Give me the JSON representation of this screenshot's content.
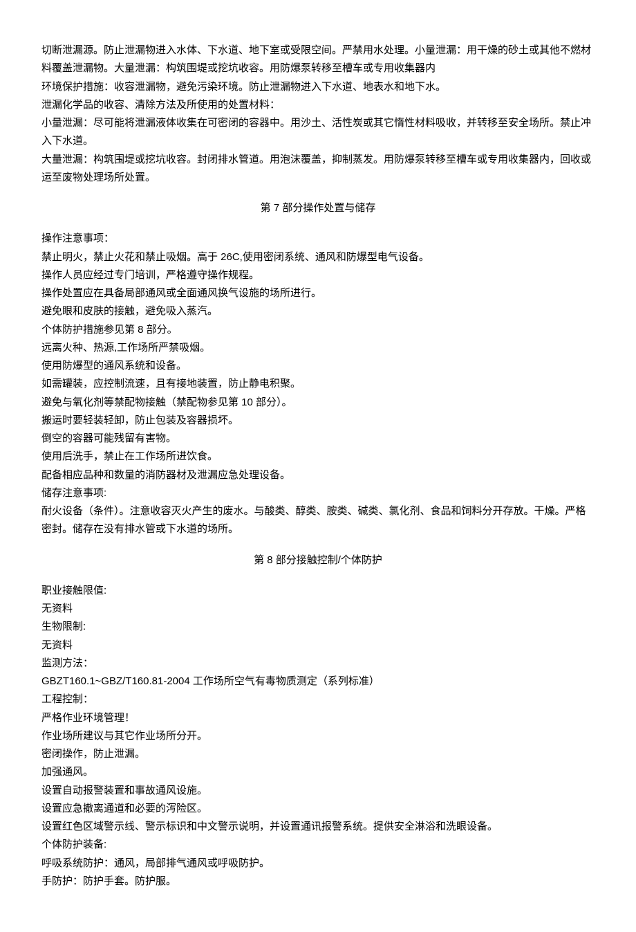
{
  "sec6": {
    "p1": "切断泄漏源。防止泄漏物进入水体、下水道、地下室或受限空间。严禁用水处理。小量泄漏：用干燥的砂土或其他不燃材料覆盖泄漏物。大量泄漏：构筑围堤或挖坑收容。用防爆泵转移至槽车或专用收集器内",
    "p2": "环境保护措施：收容泄漏物，避免污染环境。防止泄漏物进入下水道、地表水和地下水。",
    "p3": "泄漏化学品的收容、清除方法及所使用的处置材料：",
    "p4": "小量泄漏：尽可能将泄漏液体收集在可密闭的容器中。用沙土、活性炭或其它惰性材料吸收，并转移至安全场所。禁止冲入下水道。",
    "p5": "大量泄漏：构筑围堤或挖坑收容。封闭排水管道。用泡沫覆盖，抑制蒸发。用防爆泵转移至槽车或专用收集器内，回收或运至废物处理场所处置。"
  },
  "sec7": {
    "heading": "第 7 部分操作处置与储存",
    "p1": "操作注意事项：",
    "p2": "禁止明火，禁止火花和禁止吸烟。高于 26C,使用密闭系统、通风和防爆型电气设备。",
    "p3": "操作人员应经过专门培训，严格遵守操作规程。",
    "p4": "操作处置应在具备局部通风或全面通风换气设施的场所进行。",
    "p5": "避免眼和皮肤的接触，避免吸入蒸汽。",
    "p6": "个体防护措施参见第 8 部分。",
    "p7": "远离火种、热源,工作场所严禁吸烟。",
    "p8": "使用防爆型的通风系统和设备。",
    "p9": "如需罐装，应控制流速，且有接地装置，防止静电积聚。",
    "p10": "避免与氧化剂等禁配物接触（禁配物参见第 10 部分）。",
    "p11": "搬运时要轻装轻卸，防止包装及容器损坏。",
    "p12": "倒空的容器可能残留有害物。",
    "p13": "使用后洗手，禁止在工作场所进饮食。",
    "p14": "配备相应品种和数量的消防器材及泄漏应急处理设备。",
    "p15": "储存注意事项:",
    "p16": "耐火设备（条件）。注意收容灭火产生的废水。与酸类、醇类、胺类、碱类、氯化剂、食品和饲料分开存放。干燥。严格密封。储存在没有排水管或下水道的场所。"
  },
  "sec8": {
    "heading": "第 8 部分接触控制/个体防护",
    "p1": "职业接触限值:",
    "p2": "无资料",
    "p3": "生物限制:",
    "p4": "无资料",
    "p5": "监测方法：",
    "p6": "GBZT160.1~GBZ/T160.81-2004 工作场所空气有毒物质测定（系列标准）",
    "p7": "工程控制：",
    "p8": "严格作业环境管理！",
    "p9": "作业场所建议与其它作业场所分开。",
    "p10": "密闭操作，防止泄漏。",
    "p11": "加强通风。",
    "p12": "设置自动报警装置和事故通风设施。",
    "p13": "设置应急撤离通道和必要的泻险区。",
    "p14": "设置红色区域警示线、警示标识和中文警示说明，并设置通讯报警系统。提供安全淋浴和洗眼设备。",
    "p15": "个体防护装备:",
    "p16": "呼吸系统防护：通风，局部排气通风或呼吸防护。",
    "p17": "手防护：防护手套。防护服。"
  }
}
